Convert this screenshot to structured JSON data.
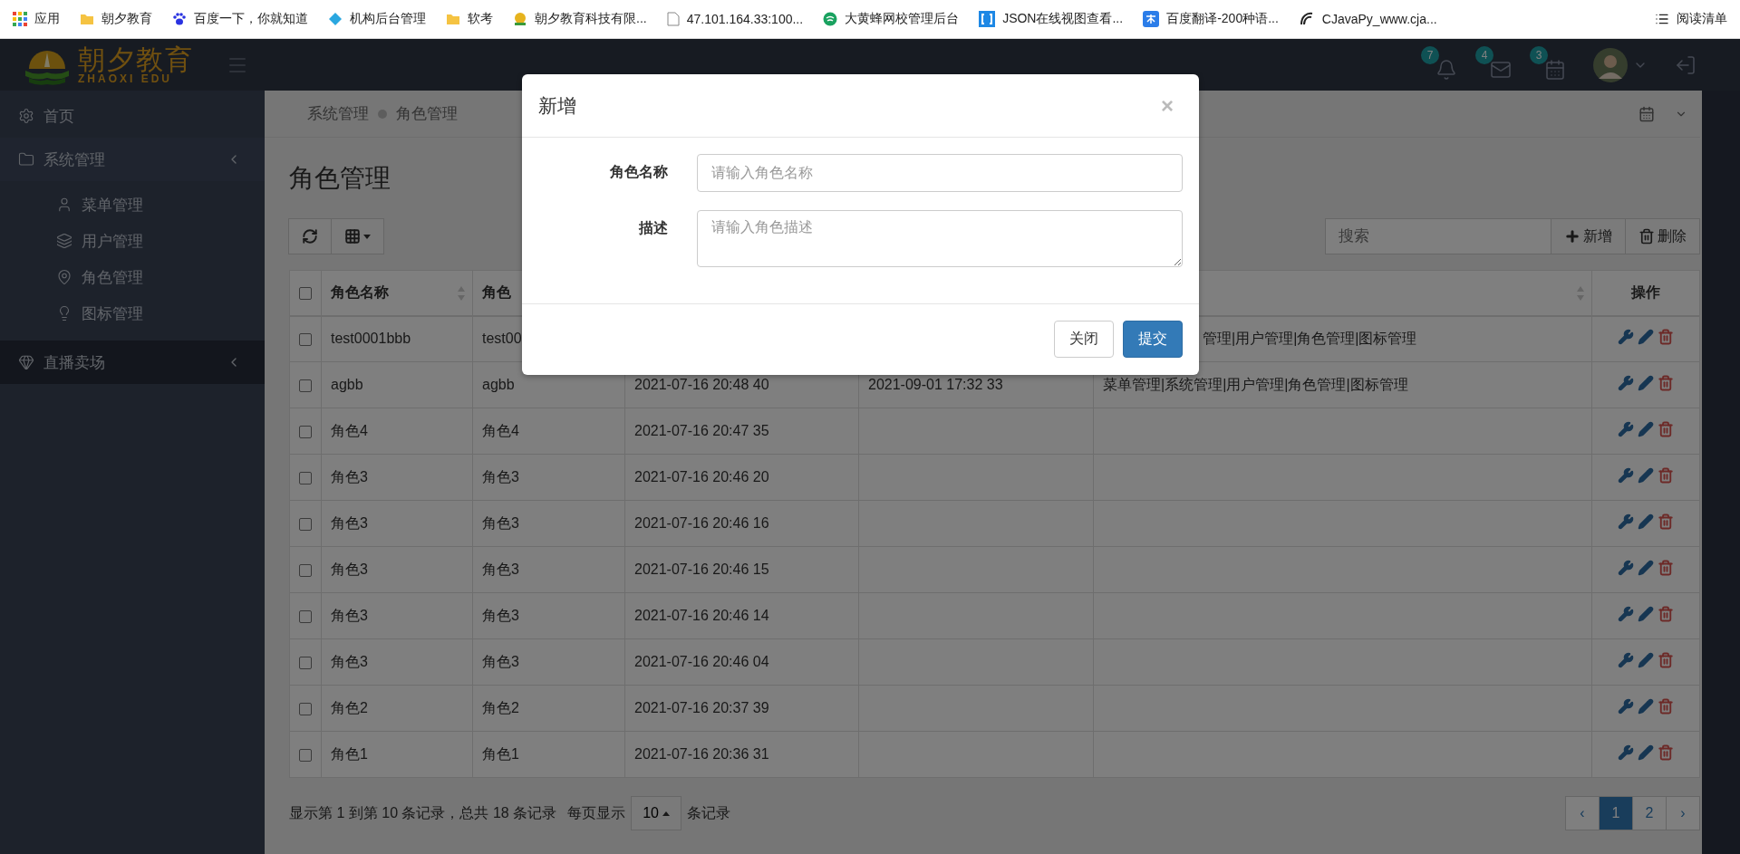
{
  "bookmarks": [
    {
      "kind": "apps",
      "label": "应用"
    },
    {
      "kind": "folder",
      "label": "朝夕教育"
    },
    {
      "kind": "paw",
      "label": "百度一下，你就知道"
    },
    {
      "kind": "diamond",
      "label": "机构后台管理"
    },
    {
      "kind": "folder",
      "label": "软考"
    },
    {
      "kind": "sun",
      "label": "朝夕教育科技有限..."
    },
    {
      "kind": "file",
      "label": "47.101.164.33:100..."
    },
    {
      "kind": "spiral",
      "label": "大黄蜂网校管理后台"
    },
    {
      "kind": "json",
      "label": "JSON在线视图查看..."
    },
    {
      "kind": "translate",
      "label": "百度翻译-200种语..."
    },
    {
      "kind": "cjava",
      "label": "CJavaPy_www.cja..."
    }
  ],
  "reading_list": "阅读清单",
  "logo": {
    "title": "朝夕教育",
    "subtitle": "ZHAOXI EDU"
  },
  "header": {
    "badges": [
      {
        "kind": "bell",
        "count": "7"
      },
      {
        "kind": "mail",
        "count": "4"
      },
      {
        "kind": "calendar",
        "count": "3"
      }
    ]
  },
  "sidebar": {
    "items": [
      {
        "kind": "gear",
        "label": "首页"
      },
      {
        "kind": "folder",
        "label": "系统管理",
        "expanded": true,
        "children": [
          {
            "kind": "user",
            "label": "菜单管理"
          },
          {
            "kind": "layers",
            "label": "用户管理"
          },
          {
            "kind": "pin",
            "label": "角色管理"
          },
          {
            "kind": "bulb",
            "label": "图标管理"
          }
        ]
      },
      {
        "kind": "gem",
        "label": "直播卖场",
        "expanded": false
      }
    ]
  },
  "breadcrumb": [
    "系统管理",
    "角色管理"
  ],
  "page_title": "角色管理",
  "search": {
    "placeholder": "搜索"
  },
  "actions": [
    {
      "kind": "add",
      "label": "新增"
    },
    {
      "kind": "delete",
      "label": "删除"
    }
  ],
  "table": {
    "columns": [
      {
        "label": "角色名称",
        "sortable": true
      },
      {
        "label": "角色"
      },
      {},
      {},
      {
        "sortable": true
      },
      {
        "label": "操作",
        "sortable": false
      }
    ],
    "header_checked": false,
    "rows": [
      {
        "checked": false,
        "name": "test0001bbb",
        "description": "test00",
        "permissions": "管理|用户管理|角色管理|图标管理"
      },
      {
        "checked": false,
        "name": "agbb",
        "description": "agbb",
        "created": "2021-07-16 20:48 40",
        "updated": "2021-09-01 17:32 33",
        "permissions": "菜单管理|系统管理|用户管理|角色管理|图标管理"
      },
      {
        "checked": false,
        "name": "角色4",
        "description": "角色4",
        "created": "2021-07-16 20:47 35"
      },
      {
        "checked": false,
        "name": "角色3",
        "description": "角色3",
        "created": "2021-07-16 20:46 20"
      },
      {
        "checked": false,
        "name": "角色3",
        "description": "角色3",
        "created": "2021-07-16 20:46 16"
      },
      {
        "checked": false,
        "name": "角色3",
        "description": "角色3",
        "created": "2021-07-16 20:46 15"
      },
      {
        "checked": false,
        "name": "角色3",
        "description": "角色3",
        "created": "2021-07-16 20:46 14"
      },
      {
        "checked": false,
        "name": "角色3",
        "description": "角色3",
        "created": "2021-07-16 20:46 04"
      },
      {
        "checked": false,
        "name": "角色2",
        "description": "角色2",
        "created": "2021-07-16 20:37 39"
      },
      {
        "checked": false,
        "name": "角色1",
        "description": "角色1",
        "created": "2021-07-16 20:36 31"
      }
    ]
  },
  "pagination": {
    "summary": "显示第 1 到第 10 条记录，总共 18 条记录",
    "per_page_label": "每页显示",
    "per_page": "10",
    "per_page_suffix": "条记录",
    "prev": "‹",
    "next": "›",
    "pages": [
      {
        "label": "1",
        "selected": true
      },
      {
        "label": "2",
        "selected": false
      }
    ]
  },
  "modal": {
    "title": "新增",
    "close": "×",
    "fields": [
      {
        "kind": "input",
        "label": "角色名称",
        "placeholder": "请输入角色名称"
      },
      {
        "kind": "textarea",
        "label": "描述",
        "placeholder": "请输入角色描述"
      }
    ],
    "buttons": [
      {
        "kind": "default",
        "label": "关闭"
      },
      {
        "kind": "primary",
        "label": "提交"
      }
    ]
  }
}
